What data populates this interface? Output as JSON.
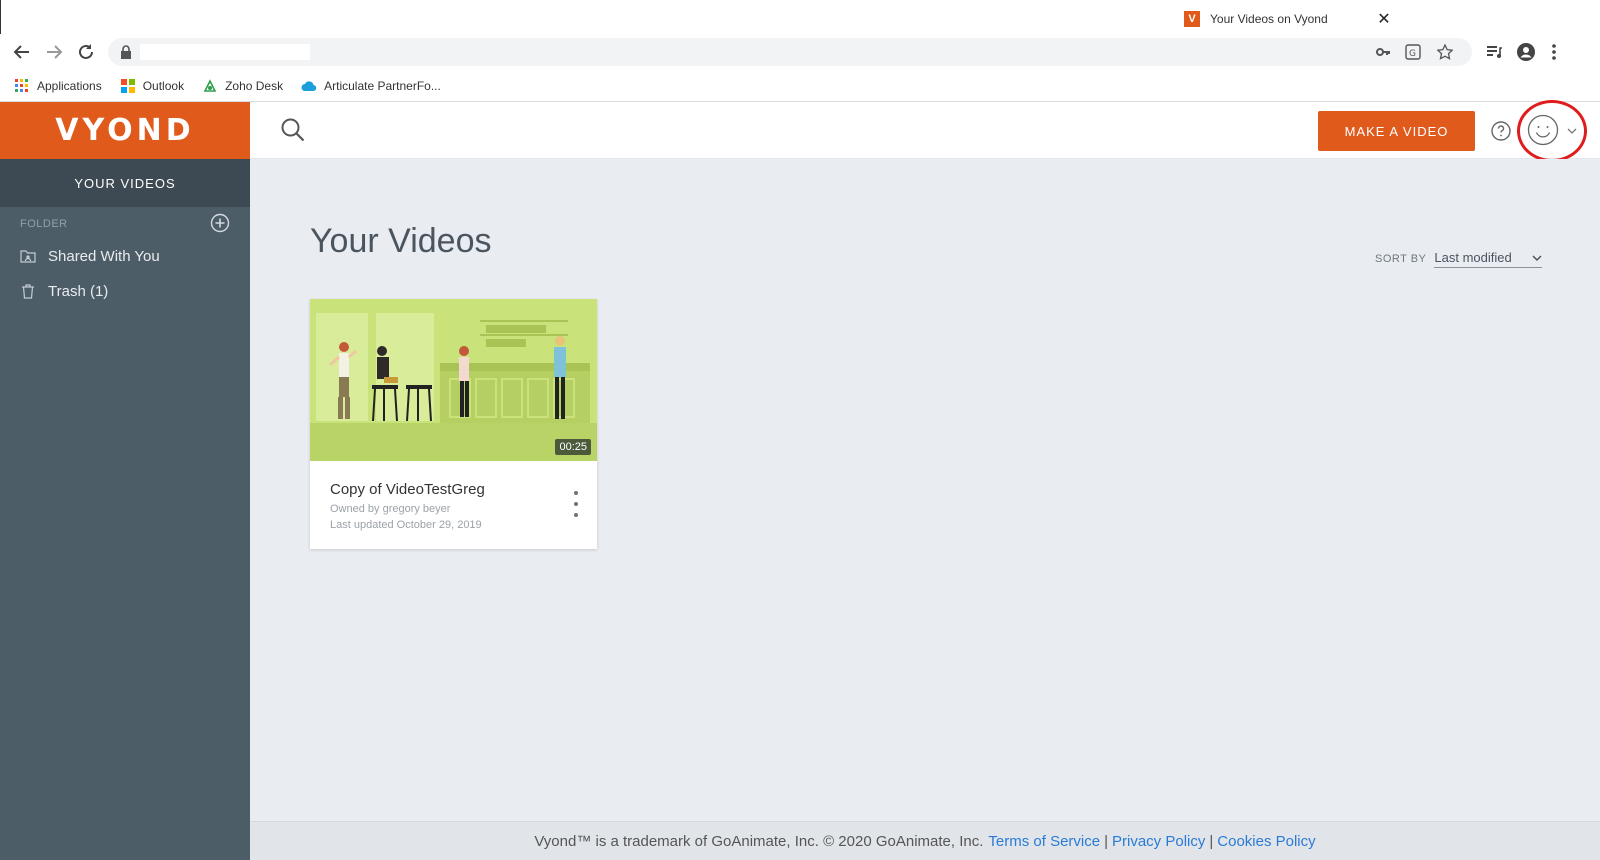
{
  "browser": {
    "tab_title": "Your Videos on Vyond",
    "tab_favicon_letter": "V",
    "tab_close": "✕",
    "bookmarks": [
      {
        "label": "Applications",
        "icon": "apps-grid-icon"
      },
      {
        "label": "Outlook",
        "icon": "microsoft-icon"
      },
      {
        "label": "Zoho Desk",
        "icon": "zoho-desk-icon"
      },
      {
        "label": "Articulate PartnerFo...",
        "icon": "salesforce-cloud-icon"
      }
    ]
  },
  "sidebar": {
    "logo": "VYOND",
    "heading": "YOUR VIDEOS",
    "folder_label": "FOLDER",
    "items": [
      {
        "label": "Shared With You",
        "icon": "shared-folder-icon"
      },
      {
        "label": "Trash (1)",
        "icon": "trash-icon"
      }
    ]
  },
  "topbar": {
    "make_video_label": "MAKE A VIDEO"
  },
  "main": {
    "title": "Your Videos",
    "sort_label": "SORT BY",
    "sort_value": "Last modified",
    "videos": [
      {
        "title": "Copy of VideoTestGreg",
        "owner": "Owned by gregory beyer",
        "updated": "Last updated October 29, 2019",
        "duration": "00:25"
      }
    ]
  },
  "footer": {
    "text": "Vyond™ is a trademark of GoAnimate, Inc. © 2020 GoAnimate, Inc.",
    "links": [
      "Terms of Service",
      "Privacy Policy",
      "Cookies Policy"
    ],
    "separator": "|"
  },
  "colors": {
    "brand_orange": "#e05a1c",
    "sidebar": "#4d5d68",
    "annotation_red": "#e01d1d",
    "link_blue": "#2a7bd6"
  }
}
